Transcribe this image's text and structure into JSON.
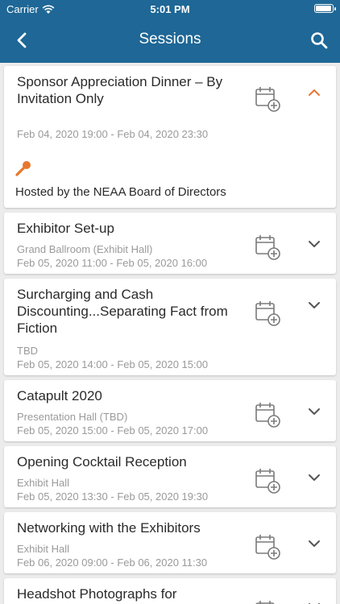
{
  "status": {
    "carrier": "Carrier",
    "time": "5:01 PM"
  },
  "nav": {
    "title": "Sessions",
    "back_icon": "chevron-left-icon",
    "search_icon": "search-icon"
  },
  "colors": {
    "bar": "#1e6796",
    "accent": "#e8772e"
  },
  "sessions": [
    {
      "name": "Sponsor Appreciation Dinner – By Invitation Only",
      "location": "",
      "time": "Feb 04, 2020 19:00 - Feb 04, 2020 23:30",
      "expanded": true,
      "description": "Hosted by the NEAA Board of Directors"
    },
    {
      "name": "Exhibitor Set-up",
      "location": "Grand Ballroom (Exhibit Hall)",
      "time": "Feb 05, 2020 11:00 - Feb 05, 2020 16:00"
    },
    {
      "name": "Surcharging and Cash Discounting...Separating Fact from Fiction",
      "location": "TBD",
      "time": "Feb 05, 2020 14:00 - Feb 05, 2020 15:00"
    },
    {
      "name": "Catapult 2020",
      "location": "Presentation Hall (TBD)",
      "time": "Feb 05, 2020 15:00 - Feb 05, 2020 17:00"
    },
    {
      "name": "Opening Cocktail Reception",
      "location": "Exhibit Hall",
      "time": "Feb 05, 2020 13:30 - Feb 05, 2020 19:30"
    },
    {
      "name": "Networking with the Exhibitors",
      "location": "Exhibit Hall",
      "time": "Feb 06, 2020 09:00 - Feb 06, 2020 11:30"
    },
    {
      "name": "Headshot Photographs for",
      "location": "",
      "time": ""
    }
  ]
}
